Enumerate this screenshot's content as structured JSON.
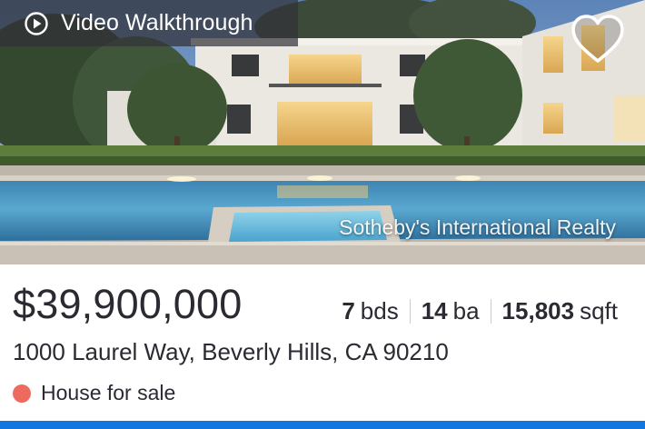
{
  "photo": {
    "video_label": "Video Walkthrough",
    "video_icon": "play-circle-icon",
    "favorite_icon": "heart-outline-icon",
    "watermark": "Sotheby's International Realty"
  },
  "listing": {
    "price": "$39,900,000",
    "beds": {
      "value": "7",
      "unit": "bds"
    },
    "baths": {
      "value": "14",
      "unit": "ba"
    },
    "sqft": {
      "value": "15,803",
      "unit": "sqft"
    },
    "address": "1000 Laurel Way, Beverly Hills, CA 90210",
    "status": "House for sale",
    "status_color": "#ec6b5e"
  },
  "colors": {
    "accent_bar": "#1277e1",
    "text": "#2a2a33"
  }
}
